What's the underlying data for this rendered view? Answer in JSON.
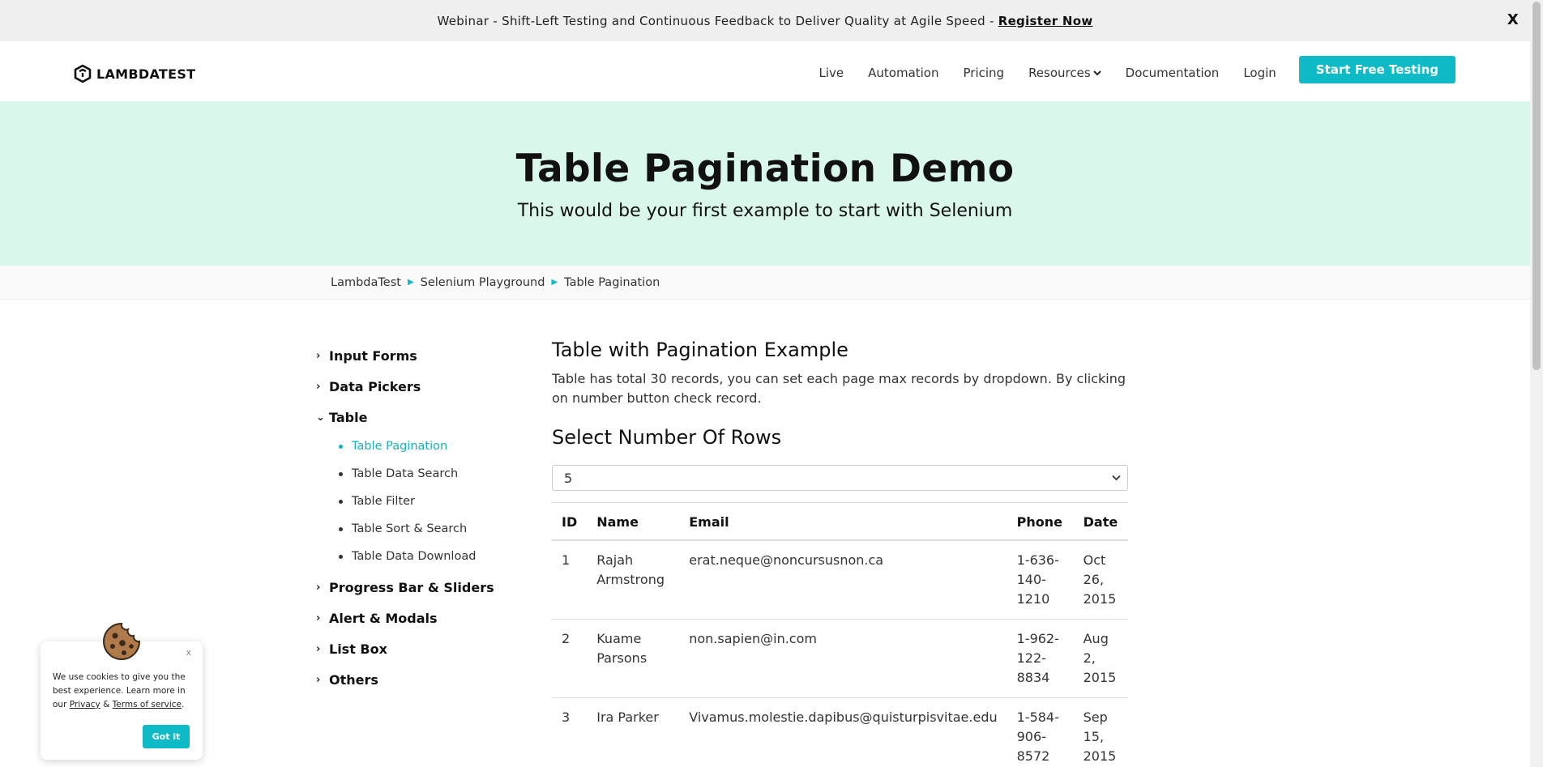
{
  "banner": {
    "text": "Webinar - Shift-Left Testing and Continuous Feedback to Deliver Quality at Agile Speed -",
    "link": "Register Now",
    "close": "X"
  },
  "nav": {
    "logo": "LAMBDATEST",
    "items": [
      "Live",
      "Automation",
      "Pricing",
      "Resources",
      "Documentation",
      "Login"
    ],
    "cta": "Start Free Testing"
  },
  "hero": {
    "title": "Table Pagination Demo",
    "subtitle": "This would be your first example to start with Selenium"
  },
  "breadcrumb": [
    "LambdaTest",
    "Selenium Playground",
    "Table Pagination"
  ],
  "sidebar": {
    "groups": [
      "Input Forms",
      "Data Pickers",
      "Table",
      "Progress Bar & Sliders",
      "Alert & Modals",
      "List Box",
      "Others"
    ],
    "table_items": [
      "Table Pagination",
      "Table Data Search",
      "Table Filter",
      "Table Sort & Search",
      "Table Data Download"
    ],
    "active_item": "Table Pagination"
  },
  "main": {
    "title": "Table with Pagination Example",
    "description": "Table has total 30 records, you can set each page max records by dropdown. By clicking on number button check record.",
    "select_heading": "Select Number Of Rows",
    "select_value": "5",
    "columns": [
      "ID",
      "Name",
      "Email",
      "Phone",
      "Date"
    ],
    "rows": [
      {
        "id": "1",
        "name": "Rajah Armstrong",
        "email": "erat.neque@noncursusnon.ca",
        "phone": "1-636-140-1210",
        "date": "Oct 26, 2015"
      },
      {
        "id": "2",
        "name": "Kuame Parsons",
        "email": "non.sapien@in.com",
        "phone": "1-962-122-8834",
        "date": "Aug 2, 2015"
      },
      {
        "id": "3",
        "name": "Ira Parker",
        "email": "Vivamus.molestie.dapibus@quisturpisvitae.edu",
        "phone": "1-584-906-8572",
        "date": "Sep 15, 2015"
      }
    ]
  },
  "cookie": {
    "text_a": "We use cookies to give you the best experience. Learn more in our",
    "privacy": "Privacy",
    "amp": "&",
    "terms": "Terms of service",
    "period": ".",
    "close": "x",
    "button": "Got it"
  },
  "colors": {
    "accent": "#0ebac5",
    "hero_bg": "#d9f7ea",
    "banner_bg": "#efefef"
  }
}
